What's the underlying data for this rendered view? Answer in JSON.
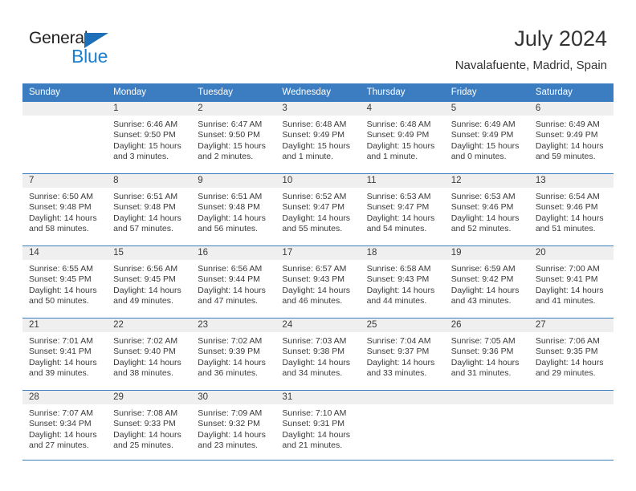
{
  "brand": {
    "name_part1": "General",
    "name_part2": "Blue",
    "color_primary": "#1d7fd0",
    "color_triangle": "#1d6fb8"
  },
  "header": {
    "title": "July 2024",
    "subtitle": "Navalafuente, Madrid, Spain"
  },
  "theme": {
    "header_row_bg": "#3b7dc0",
    "daynum_band_bg": "#efefef",
    "grid_line": "#3b7dc0",
    "text": "#3a3a3a"
  },
  "weekday_headers": [
    "Sunday",
    "Monday",
    "Tuesday",
    "Wednesday",
    "Thursday",
    "Friday",
    "Saturday"
  ],
  "weeks": [
    [
      {
        "day": "",
        "sunrise": "",
        "sunset": "",
        "daylight_line1": "",
        "daylight_line2": ""
      },
      {
        "day": "1",
        "sunrise": "Sunrise: 6:46 AM",
        "sunset": "Sunset: 9:50 PM",
        "daylight_line1": "Daylight: 15 hours",
        "daylight_line2": "and 3 minutes."
      },
      {
        "day": "2",
        "sunrise": "Sunrise: 6:47 AM",
        "sunset": "Sunset: 9:50 PM",
        "daylight_line1": "Daylight: 15 hours",
        "daylight_line2": "and 2 minutes."
      },
      {
        "day": "3",
        "sunrise": "Sunrise: 6:48 AM",
        "sunset": "Sunset: 9:49 PM",
        "daylight_line1": "Daylight: 15 hours",
        "daylight_line2": "and 1 minute."
      },
      {
        "day": "4",
        "sunrise": "Sunrise: 6:48 AM",
        "sunset": "Sunset: 9:49 PM",
        "daylight_line1": "Daylight: 15 hours",
        "daylight_line2": "and 1 minute."
      },
      {
        "day": "5",
        "sunrise": "Sunrise: 6:49 AM",
        "sunset": "Sunset: 9:49 PM",
        "daylight_line1": "Daylight: 15 hours",
        "daylight_line2": "and 0 minutes."
      },
      {
        "day": "6",
        "sunrise": "Sunrise: 6:49 AM",
        "sunset": "Sunset: 9:49 PM",
        "daylight_line1": "Daylight: 14 hours",
        "daylight_line2": "and 59 minutes."
      }
    ],
    [
      {
        "day": "7",
        "sunrise": "Sunrise: 6:50 AM",
        "sunset": "Sunset: 9:48 PM",
        "daylight_line1": "Daylight: 14 hours",
        "daylight_line2": "and 58 minutes."
      },
      {
        "day": "8",
        "sunrise": "Sunrise: 6:51 AM",
        "sunset": "Sunset: 9:48 PM",
        "daylight_line1": "Daylight: 14 hours",
        "daylight_line2": "and 57 minutes."
      },
      {
        "day": "9",
        "sunrise": "Sunrise: 6:51 AM",
        "sunset": "Sunset: 9:48 PM",
        "daylight_line1": "Daylight: 14 hours",
        "daylight_line2": "and 56 minutes."
      },
      {
        "day": "10",
        "sunrise": "Sunrise: 6:52 AM",
        "sunset": "Sunset: 9:47 PM",
        "daylight_line1": "Daylight: 14 hours",
        "daylight_line2": "and 55 minutes."
      },
      {
        "day": "11",
        "sunrise": "Sunrise: 6:53 AM",
        "sunset": "Sunset: 9:47 PM",
        "daylight_line1": "Daylight: 14 hours",
        "daylight_line2": "and 54 minutes."
      },
      {
        "day": "12",
        "sunrise": "Sunrise: 6:53 AM",
        "sunset": "Sunset: 9:46 PM",
        "daylight_line1": "Daylight: 14 hours",
        "daylight_line2": "and 52 minutes."
      },
      {
        "day": "13",
        "sunrise": "Sunrise: 6:54 AM",
        "sunset": "Sunset: 9:46 PM",
        "daylight_line1": "Daylight: 14 hours",
        "daylight_line2": "and 51 minutes."
      }
    ],
    [
      {
        "day": "14",
        "sunrise": "Sunrise: 6:55 AM",
        "sunset": "Sunset: 9:45 PM",
        "daylight_line1": "Daylight: 14 hours",
        "daylight_line2": "and 50 minutes."
      },
      {
        "day": "15",
        "sunrise": "Sunrise: 6:56 AM",
        "sunset": "Sunset: 9:45 PM",
        "daylight_line1": "Daylight: 14 hours",
        "daylight_line2": "and 49 minutes."
      },
      {
        "day": "16",
        "sunrise": "Sunrise: 6:56 AM",
        "sunset": "Sunset: 9:44 PM",
        "daylight_line1": "Daylight: 14 hours",
        "daylight_line2": "and 47 minutes."
      },
      {
        "day": "17",
        "sunrise": "Sunrise: 6:57 AM",
        "sunset": "Sunset: 9:43 PM",
        "daylight_line1": "Daylight: 14 hours",
        "daylight_line2": "and 46 minutes."
      },
      {
        "day": "18",
        "sunrise": "Sunrise: 6:58 AM",
        "sunset": "Sunset: 9:43 PM",
        "daylight_line1": "Daylight: 14 hours",
        "daylight_line2": "and 44 minutes."
      },
      {
        "day": "19",
        "sunrise": "Sunrise: 6:59 AM",
        "sunset": "Sunset: 9:42 PM",
        "daylight_line1": "Daylight: 14 hours",
        "daylight_line2": "and 43 minutes."
      },
      {
        "day": "20",
        "sunrise": "Sunrise: 7:00 AM",
        "sunset": "Sunset: 9:41 PM",
        "daylight_line1": "Daylight: 14 hours",
        "daylight_line2": "and 41 minutes."
      }
    ],
    [
      {
        "day": "21",
        "sunrise": "Sunrise: 7:01 AM",
        "sunset": "Sunset: 9:41 PM",
        "daylight_line1": "Daylight: 14 hours",
        "daylight_line2": "and 39 minutes."
      },
      {
        "day": "22",
        "sunrise": "Sunrise: 7:02 AM",
        "sunset": "Sunset: 9:40 PM",
        "daylight_line1": "Daylight: 14 hours",
        "daylight_line2": "and 38 minutes."
      },
      {
        "day": "23",
        "sunrise": "Sunrise: 7:02 AM",
        "sunset": "Sunset: 9:39 PM",
        "daylight_line1": "Daylight: 14 hours",
        "daylight_line2": "and 36 minutes."
      },
      {
        "day": "24",
        "sunrise": "Sunrise: 7:03 AM",
        "sunset": "Sunset: 9:38 PM",
        "daylight_line1": "Daylight: 14 hours",
        "daylight_line2": "and 34 minutes."
      },
      {
        "day": "25",
        "sunrise": "Sunrise: 7:04 AM",
        "sunset": "Sunset: 9:37 PM",
        "daylight_line1": "Daylight: 14 hours",
        "daylight_line2": "and 33 minutes."
      },
      {
        "day": "26",
        "sunrise": "Sunrise: 7:05 AM",
        "sunset": "Sunset: 9:36 PM",
        "daylight_line1": "Daylight: 14 hours",
        "daylight_line2": "and 31 minutes."
      },
      {
        "day": "27",
        "sunrise": "Sunrise: 7:06 AM",
        "sunset": "Sunset: 9:35 PM",
        "daylight_line1": "Daylight: 14 hours",
        "daylight_line2": "and 29 minutes."
      }
    ],
    [
      {
        "day": "28",
        "sunrise": "Sunrise: 7:07 AM",
        "sunset": "Sunset: 9:34 PM",
        "daylight_line1": "Daylight: 14 hours",
        "daylight_line2": "and 27 minutes."
      },
      {
        "day": "29",
        "sunrise": "Sunrise: 7:08 AM",
        "sunset": "Sunset: 9:33 PM",
        "daylight_line1": "Daylight: 14 hours",
        "daylight_line2": "and 25 minutes."
      },
      {
        "day": "30",
        "sunrise": "Sunrise: 7:09 AM",
        "sunset": "Sunset: 9:32 PM",
        "daylight_line1": "Daylight: 14 hours",
        "daylight_line2": "and 23 minutes."
      },
      {
        "day": "31",
        "sunrise": "Sunrise: 7:10 AM",
        "sunset": "Sunset: 9:31 PM",
        "daylight_line1": "Daylight: 14 hours",
        "daylight_line2": "and 21 minutes."
      },
      {
        "day": "",
        "sunrise": "",
        "sunset": "",
        "daylight_line1": "",
        "daylight_line2": ""
      },
      {
        "day": "",
        "sunrise": "",
        "sunset": "",
        "daylight_line1": "",
        "daylight_line2": ""
      },
      {
        "day": "",
        "sunrise": "",
        "sunset": "",
        "daylight_line1": "",
        "daylight_line2": ""
      }
    ]
  ]
}
